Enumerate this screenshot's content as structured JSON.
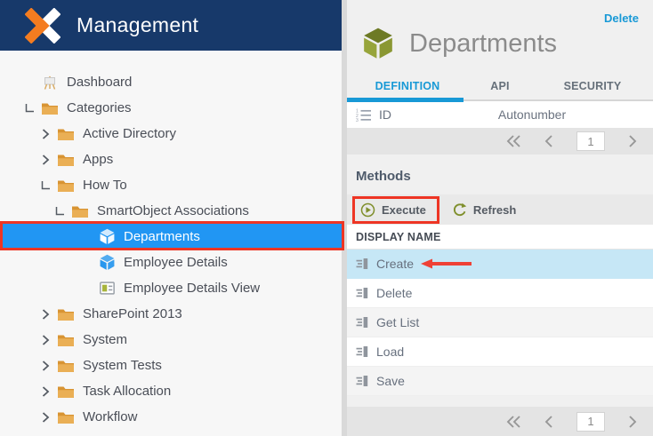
{
  "header": {
    "title": "Management"
  },
  "sidebar": {
    "items": [
      {
        "label": "Dashboard"
      },
      {
        "label": "Categories"
      },
      {
        "label": "Active Directory"
      },
      {
        "label": "Apps"
      },
      {
        "label": "How To"
      },
      {
        "label": "SmartObject Associations"
      },
      {
        "label": "Departments"
      },
      {
        "label": "Employee Details"
      },
      {
        "label": "Employee Details View"
      },
      {
        "label": "SharePoint 2013"
      },
      {
        "label": "System"
      },
      {
        "label": "System Tests"
      },
      {
        "label": "Task Allocation"
      },
      {
        "label": "Workflow"
      }
    ]
  },
  "detail": {
    "delete_link": "Delete",
    "title": "Departments",
    "tabs": {
      "definition": "DEFINITION",
      "api": "API",
      "security": "SECURITY"
    },
    "property": {
      "name": "ID",
      "type": "Autonumber"
    },
    "pager_top": {
      "page": "1"
    },
    "methods": {
      "heading": "Methods",
      "execute_label": "Execute",
      "refresh_label": "Refresh",
      "column_header": "DISPLAY NAME",
      "rows": [
        {
          "name": "Create"
        },
        {
          "name": "Delete"
        },
        {
          "name": "Get List"
        },
        {
          "name": "Load"
        },
        {
          "name": "Save"
        }
      ],
      "pager": {
        "page": "1"
      }
    }
  },
  "colors": {
    "header_navy": "#17396a",
    "brand_orange": "#f47c20",
    "selection_blue": "#2196f3",
    "accent_blue": "#1899d6",
    "annotation_red": "#ee3524",
    "olive_green": "#7f8f2c",
    "folder_orange": "#e9ab4f"
  }
}
